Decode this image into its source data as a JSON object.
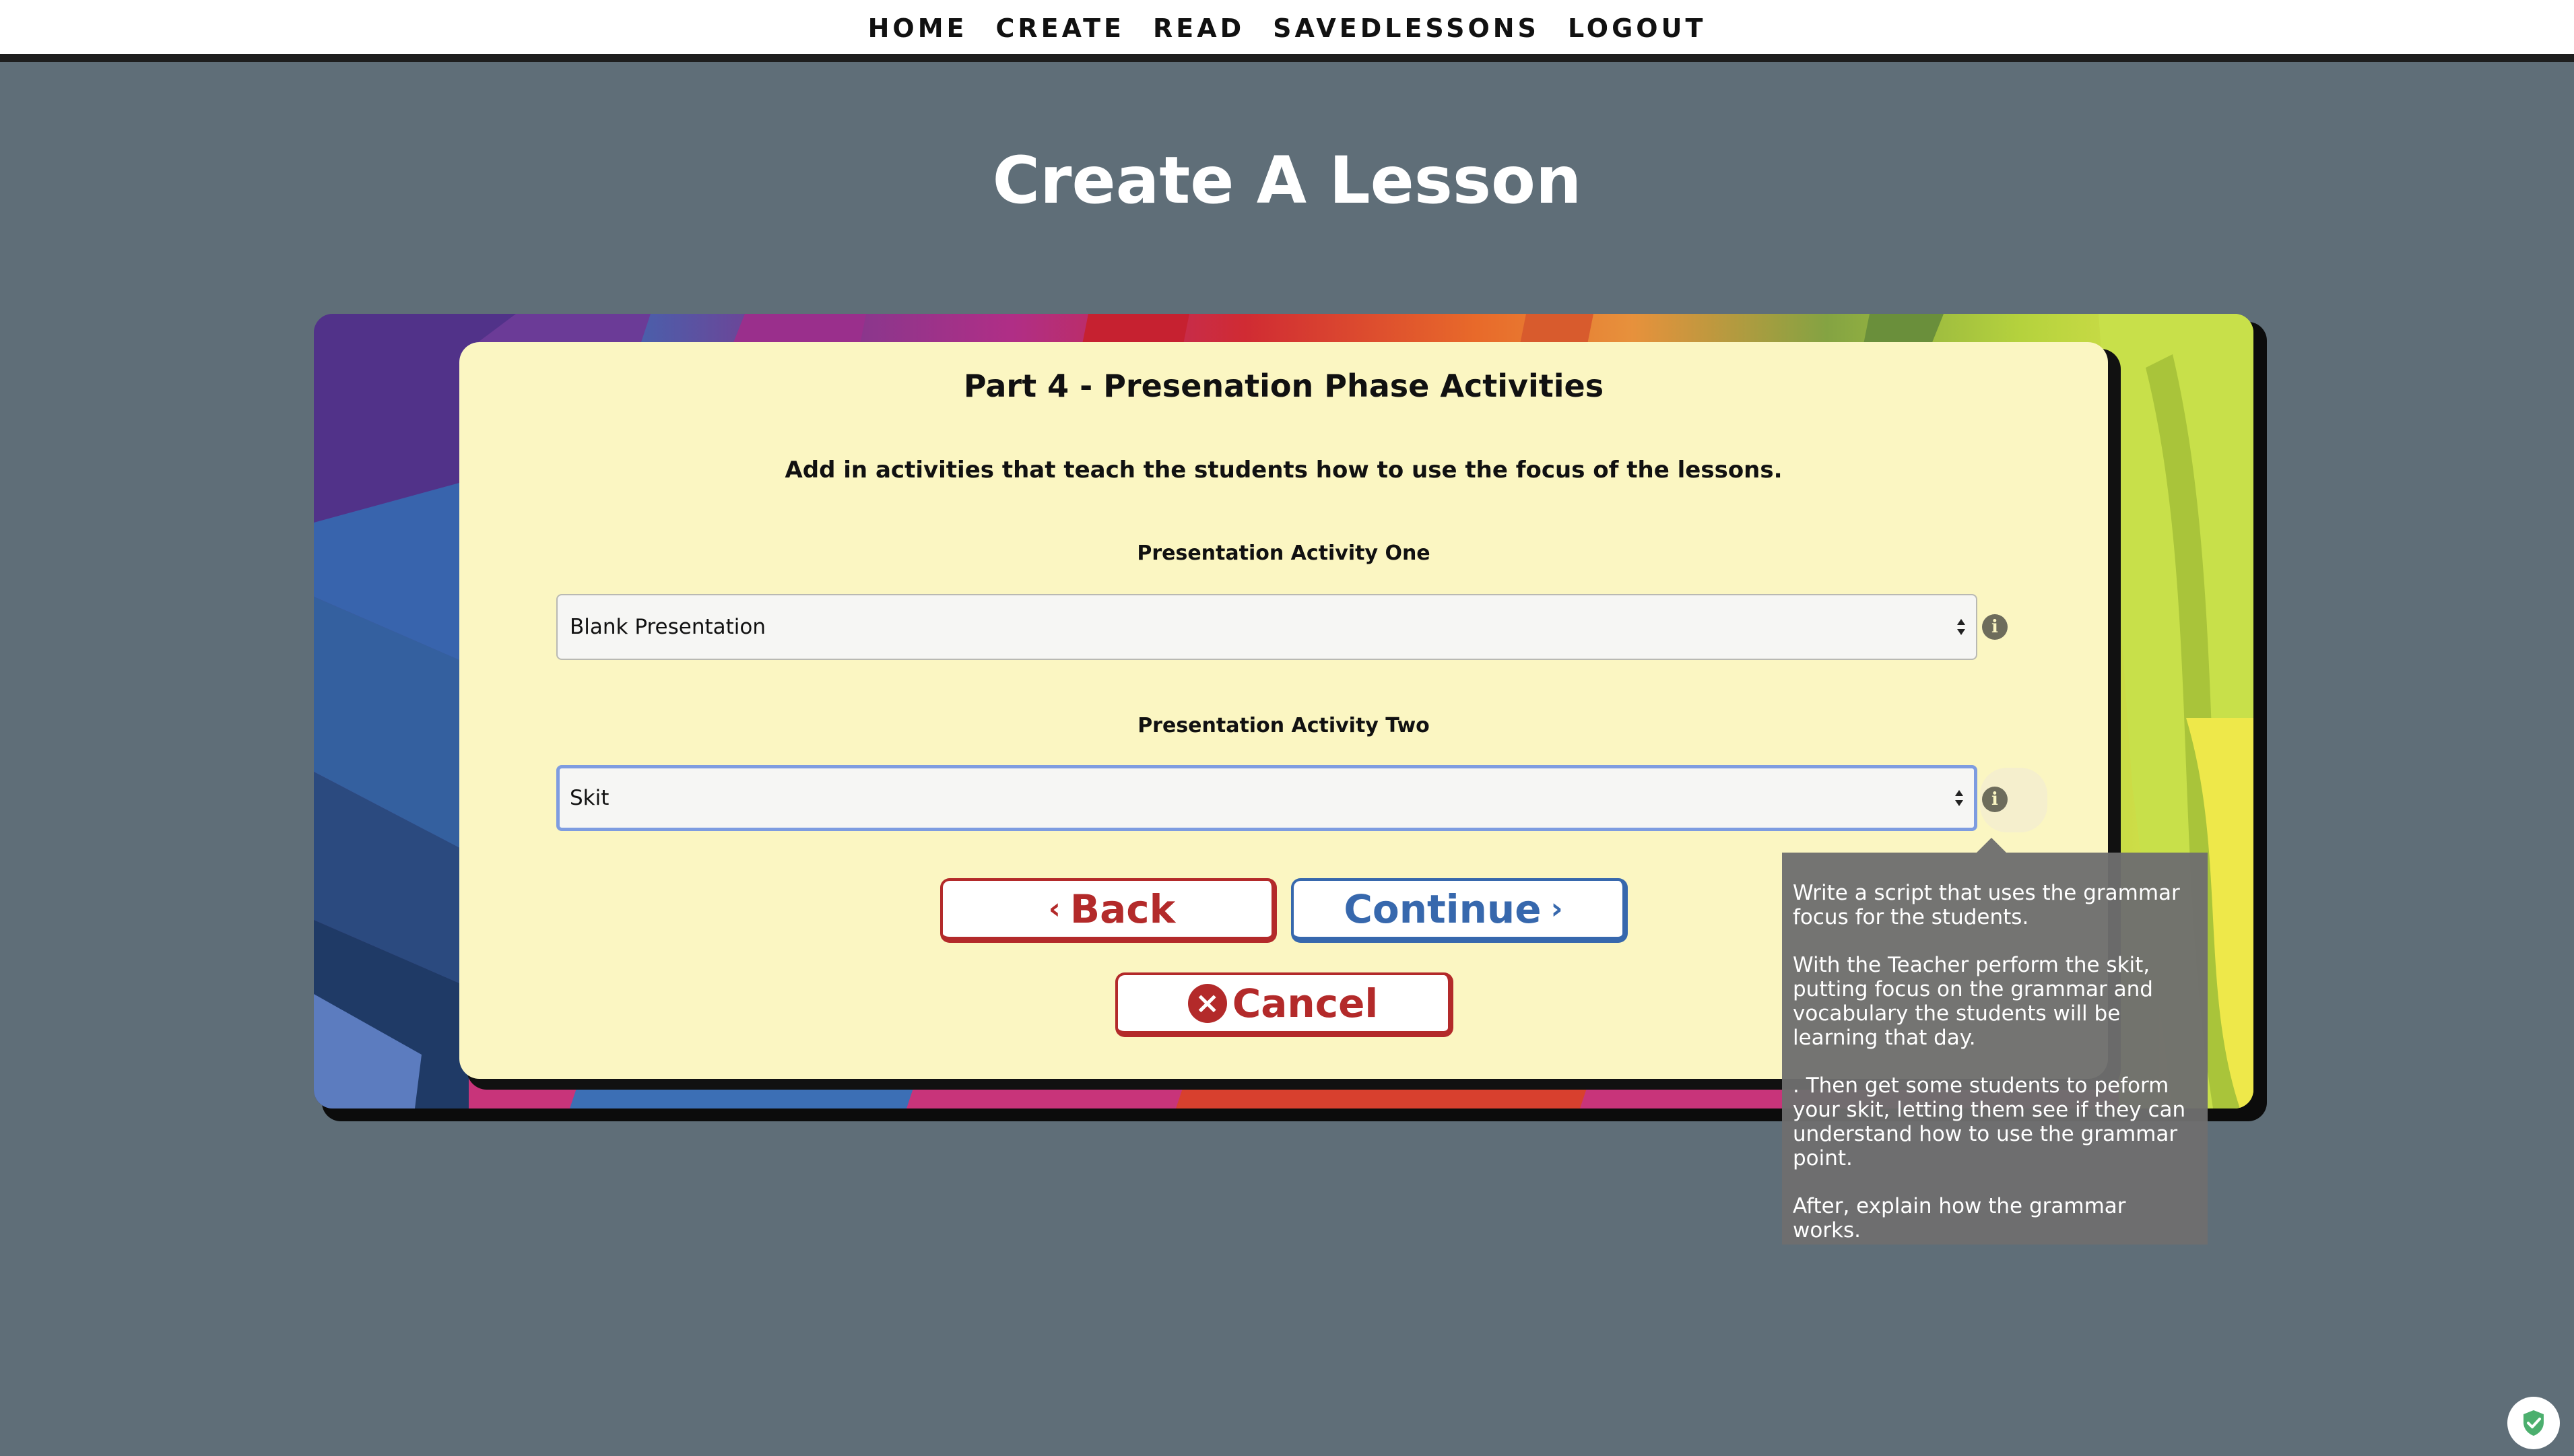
{
  "nav": {
    "home": "HOME",
    "create": "CREATE",
    "read": "READ",
    "saved": "SAVEDLESSONS",
    "logout": "LOGOUT"
  },
  "page": {
    "title": "Create A Lesson"
  },
  "form": {
    "part_title": "Part 4 - Presenation Phase Activities",
    "description": "Add in activities that teach the students how to use the focus of the lessons.",
    "activity_one": {
      "label": "Presentation Activity One",
      "value": "Blank Presentation"
    },
    "activity_two": {
      "label": "Presentation Activity Two",
      "value": "Skit"
    },
    "info_glyph": "i"
  },
  "buttons": {
    "back": "Back",
    "continue": "Continue",
    "cancel": "Cancel"
  },
  "tooltip": {
    "p1": "Write a script that uses the grammar focus for the students.",
    "p2": "With the Teacher perform the skit, putting focus on the grammar and vocabulary the students will be learning that day.",
    "p3": ". Then get some students to peform your skit, letting them see if they can understand how to use the grammar point.",
    "p4": "After, explain how the grammar works."
  },
  "icons": {
    "info": "info-icon",
    "back_chevron": "chevron-left-icon",
    "continue_chevron": "chevron-right-icon",
    "cancel": "close-circle-icon",
    "badge": "shield-check-icon"
  },
  "colors": {
    "background": "#5f6e78",
    "card": "#fbf6c2",
    "danger": "#b32a2a",
    "primary": "#3768ad",
    "focus_ring": "#7e9ce0",
    "tooltip": "#6e6e6e"
  }
}
